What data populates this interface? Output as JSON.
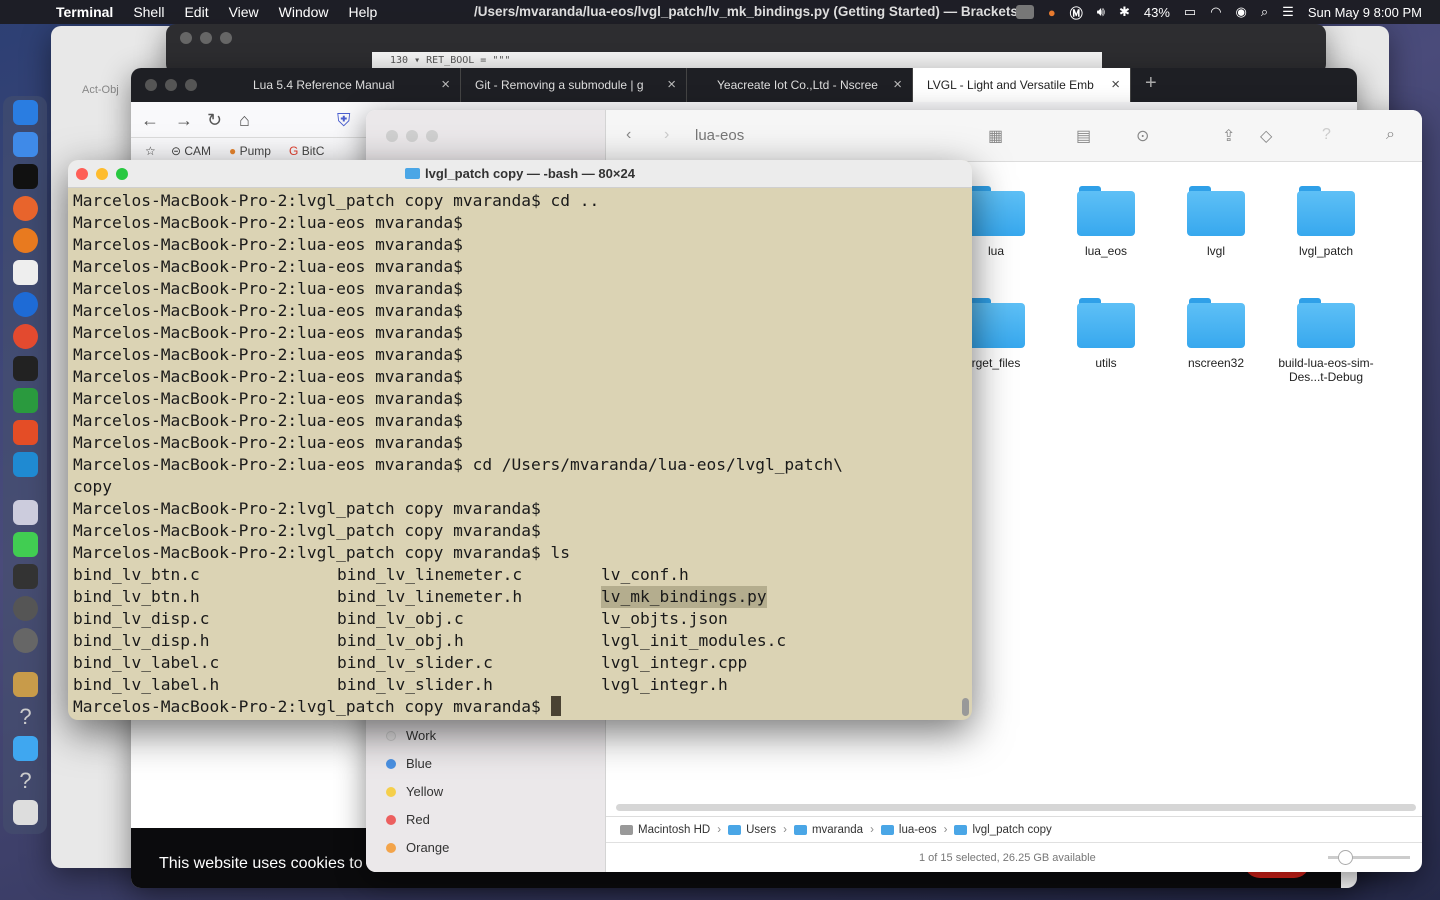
{
  "menubar": {
    "app_name": "Terminal",
    "menus": [
      "Shell",
      "Edit",
      "View",
      "Window",
      "Help"
    ],
    "window_title": "/Users/mvaranda/lua-eos/lvgl_patch/lv_mk_bindings.py (Getting Started) — Brackets",
    "battery": "43%",
    "datetime": "Sun May 9  8:00 PM"
  },
  "back_window": {
    "label": "Act-Obj"
  },
  "brackets": {
    "code_line": "130 ▾ RET_BOOL = \"\"\""
  },
  "browser": {
    "tabs": [
      {
        "label": "Lua 5.4 Reference Manual"
      },
      {
        "label": "Git - Removing a submodule | g"
      },
      {
        "label": "Yeacreate Iot Co.,Ltd - Nscree"
      },
      {
        "label": "LVGL - Light and Versatile Emb"
      }
    ],
    "bookmarks": [
      "CAM",
      "Pump",
      "BitC"
    ],
    "cookie_text": "This website uses cookies to"
  },
  "finder": {
    "path_title": "lua-eos",
    "items": [
      {
        "name": "lua"
      },
      {
        "name": "lua_eos"
      },
      {
        "name": "lvgl"
      },
      {
        "name": "lvgl_patch"
      },
      {
        "name": "rget_files"
      },
      {
        "name": "utils"
      },
      {
        "name": "nscreen32"
      },
      {
        "name": "build-lua-eos-sim-Des...t-Debug"
      }
    ],
    "tags": [
      {
        "name": "Work",
        "color": "#e4e2e3"
      },
      {
        "name": "Blue",
        "color": "#4a90e2"
      },
      {
        "name": "Yellow",
        "color": "#f5cf4b"
      },
      {
        "name": "Red",
        "color": "#ec5f5f"
      },
      {
        "name": "Orange",
        "color": "#f3a44a"
      }
    ],
    "breadcrumb": [
      "Macintosh HD",
      "Users",
      "mvaranda",
      "lua-eos",
      "lvgl_patch copy"
    ],
    "status": "1 of 15 selected, 26.25 GB available"
  },
  "terminal": {
    "title": "lvgl_patch copy — -bash — 80×24",
    "lines": [
      "Marcelos-MacBook-Pro-2:lvgl_patch copy mvaranda$ cd ..",
      "Marcelos-MacBook-Pro-2:lua-eos mvaranda$",
      "Marcelos-MacBook-Pro-2:lua-eos mvaranda$",
      "Marcelos-MacBook-Pro-2:lua-eos mvaranda$",
      "Marcelos-MacBook-Pro-2:lua-eos mvaranda$",
      "Marcelos-MacBook-Pro-2:lua-eos mvaranda$",
      "Marcelos-MacBook-Pro-2:lua-eos mvaranda$",
      "Marcelos-MacBook-Pro-2:lua-eos mvaranda$",
      "Marcelos-MacBook-Pro-2:lua-eos mvaranda$",
      "Marcelos-MacBook-Pro-2:lua-eos mvaranda$",
      "Marcelos-MacBook-Pro-2:lua-eos mvaranda$",
      "Marcelos-MacBook-Pro-2:lua-eos mvaranda$",
      "Marcelos-MacBook-Pro-2:lua-eos mvaranda$ cd /Users/mvaranda/lua-eos/lvgl_patch\\",
      "copy",
      "Marcelos-MacBook-Pro-2:lvgl_patch copy mvaranda$",
      "Marcelos-MacBook-Pro-2:lvgl_patch copy mvaranda$",
      "Marcelos-MacBook-Pro-2:lvgl_patch copy mvaranda$ ls"
    ],
    "ls_rows": [
      [
        "bind_lv_btn.c",
        "bind_lv_linemeter.c",
        "lv_conf.h"
      ],
      [
        "bind_lv_btn.h",
        "bind_lv_linemeter.h",
        "lv_mk_bindings.py"
      ],
      [
        "bind_lv_disp.c",
        "bind_lv_obj.c",
        "lv_objts.json"
      ],
      [
        "bind_lv_disp.h",
        "bind_lv_obj.h",
        "lvgl_init_modules.c"
      ],
      [
        "bind_lv_label.c",
        "bind_lv_slider.c",
        "lvgl_integr.cpp"
      ],
      [
        "bind_lv_label.h",
        "bind_lv_slider.h",
        "lvgl_integr.h"
      ]
    ],
    "prompt": "Marcelos-MacBook-Pro-2:lvgl_patch copy mvaranda$ "
  }
}
